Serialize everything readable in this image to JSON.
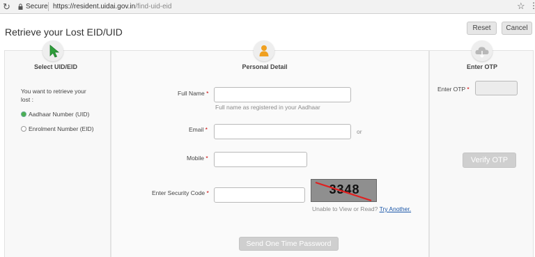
{
  "browser": {
    "secure_label": "Secure",
    "url_host": "https://resident.uidai.gov.in",
    "url_path": "/find-uid-eid"
  },
  "page": {
    "title": "Retrieve your Lost EID/UID",
    "reset_label": "Reset",
    "cancel_label": "Cancel"
  },
  "steps": {
    "select": {
      "title": "Select UID/EID",
      "icon": "cursor-icon"
    },
    "personal": {
      "title": "Personal Detail",
      "icon": "person-icon"
    },
    "otp": {
      "title": "Enter OTP",
      "icon": "cloud-icon"
    }
  },
  "select_panel": {
    "question_line1": "You want to retrieve your",
    "question_line2": "lost :",
    "options": [
      {
        "label": "Aadhaar Number (UID)",
        "selected": true
      },
      {
        "label": "Enrolment Number (EID)",
        "selected": false
      }
    ]
  },
  "form": {
    "full_name_label": "Full Name",
    "full_name_value": "",
    "full_name_hint": "Full name as registered in your Aadhaar",
    "email_label": "Email",
    "email_value": "",
    "or_text": "or",
    "mobile_label": "Mobile",
    "mobile_value": "",
    "security_label": "Enter Security Code",
    "security_value": "",
    "required_mark": "*",
    "captcha_text": "3348",
    "captcha_hint": "Unable to View or Read?",
    "try_another": "Try Another.",
    "send_otp": "Send One Time Password"
  },
  "otp_panel": {
    "label": "Enter OTP",
    "value": "",
    "verify": "Verify OTP"
  },
  "colors": {
    "accent_green": "#4caf50",
    "orange": "#f0a020",
    "link": "#1a56a8",
    "required": "#cc0000"
  }
}
